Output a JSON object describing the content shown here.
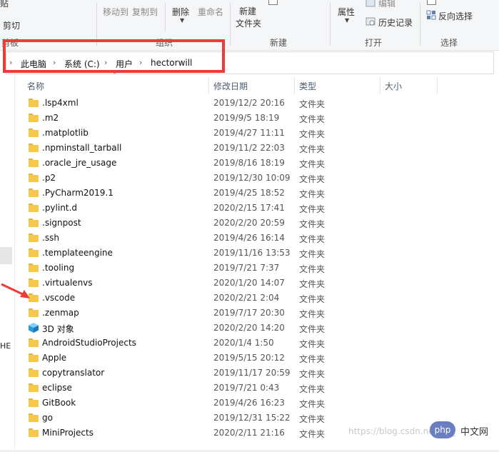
{
  "ribbon": {
    "paste_fragment": "贴",
    "cut": "剪切",
    "move_to": "移动到",
    "copy_to": "复制到",
    "delete": "删除",
    "rename": "重命名",
    "new_folder_line1": "新建",
    "new_folder_line2": "文件夹",
    "properties": "属性",
    "edit": "编辑",
    "history": "历史记录",
    "invert_selection": "反向选择",
    "group_clipboard_fragment": "剪板",
    "group_organize_fragment": "组织",
    "group_new": "新建",
    "group_open": "打开",
    "group_select": "选择"
  },
  "address": {
    "crumbs": [
      "此电脑",
      "系统 (C:)",
      "用户",
      "hectorwill"
    ]
  },
  "columns": {
    "name": "名称",
    "modified": "修改日期",
    "type": "类型",
    "size": "大小"
  },
  "left_pane_fragment": "HE",
  "files": [
    {
      "name": ".lsp4xml",
      "date": "2019/12/2 20:16",
      "type": "文件夹",
      "icon": "folder-icon"
    },
    {
      "name": ".m2",
      "date": "2019/9/5 18:19",
      "type": "文件夹",
      "icon": "folder-icon"
    },
    {
      "name": ".matplotlib",
      "date": "2019/4/27 11:11",
      "type": "文件夹",
      "icon": "folder-icon"
    },
    {
      "name": ".npminstall_tarball",
      "date": "2019/11/2 22:03",
      "type": "文件夹",
      "icon": "folder-icon"
    },
    {
      "name": ".oracle_jre_usage",
      "date": "2019/8/16 18:19",
      "type": "文件夹",
      "icon": "folder-icon"
    },
    {
      "name": ".p2",
      "date": "2019/12/30 10:09",
      "type": "文件夹",
      "icon": "folder-icon"
    },
    {
      "name": ".PyCharm2019.1",
      "date": "2019/4/25 18:52",
      "type": "文件夹",
      "icon": "folder-icon"
    },
    {
      "name": ".pylint.d",
      "date": "2020/2/15 17:41",
      "type": "文件夹",
      "icon": "folder-icon"
    },
    {
      "name": ".signpost",
      "date": "2020/2/20 20:59",
      "type": "文件夹",
      "icon": "folder-icon"
    },
    {
      "name": ".ssh",
      "date": "2019/4/26 16:14",
      "type": "文件夹",
      "icon": "folder-icon"
    },
    {
      "name": ".templateengine",
      "date": "2019/11/16 13:53",
      "type": "文件夹",
      "icon": "folder-icon"
    },
    {
      "name": ".tooling",
      "date": "2019/7/21 7:37",
      "type": "文件夹",
      "icon": "folder-icon"
    },
    {
      "name": ".virtualenvs",
      "date": "2020/1/20 14:07",
      "type": "文件夹",
      "icon": "folder-icon"
    },
    {
      "name": ".vscode",
      "date": "2020/2/21 2:04",
      "type": "文件夹",
      "icon": "folder-icon"
    },
    {
      "name": ".zenmap",
      "date": "2019/7/17 20:30",
      "type": "文件夹",
      "icon": "folder-icon"
    },
    {
      "name": "3D 对象",
      "date": "2020/2/20 14:20",
      "type": "文件夹",
      "icon": "3d-objects-icon"
    },
    {
      "name": "AndroidStudioProjects",
      "date": "2020/1/4 1:50",
      "type": "文件夹",
      "icon": "folder-icon"
    },
    {
      "name": "Apple",
      "date": "2019/5/15 20:12",
      "type": "文件夹",
      "icon": "folder-icon"
    },
    {
      "name": "copytranslator",
      "date": "2019/11/17 20:59",
      "type": "文件夹",
      "icon": "folder-icon"
    },
    {
      "name": "eclipse",
      "date": "2019/7/21 0:43",
      "type": "文件夹",
      "icon": "folder-icon"
    },
    {
      "name": "GitBook",
      "date": "2019/4/26 16:23",
      "type": "文件夹",
      "icon": "folder-icon"
    },
    {
      "name": "go",
      "date": "2019/12/31 15:22",
      "type": "文件夹",
      "icon": "folder-icon"
    },
    {
      "name": "MiniProjects",
      "date": "2020/2/11 21:16",
      "type": "文件夹",
      "icon": "folder-icon"
    }
  ],
  "watermark": "https://blog.csdn.net/qq_",
  "badge": {
    "php": "php",
    "site": "中文网"
  },
  "colors": {
    "highlight_red": "#ec3b3b",
    "folder_yellow": "#f4c84b"
  }
}
